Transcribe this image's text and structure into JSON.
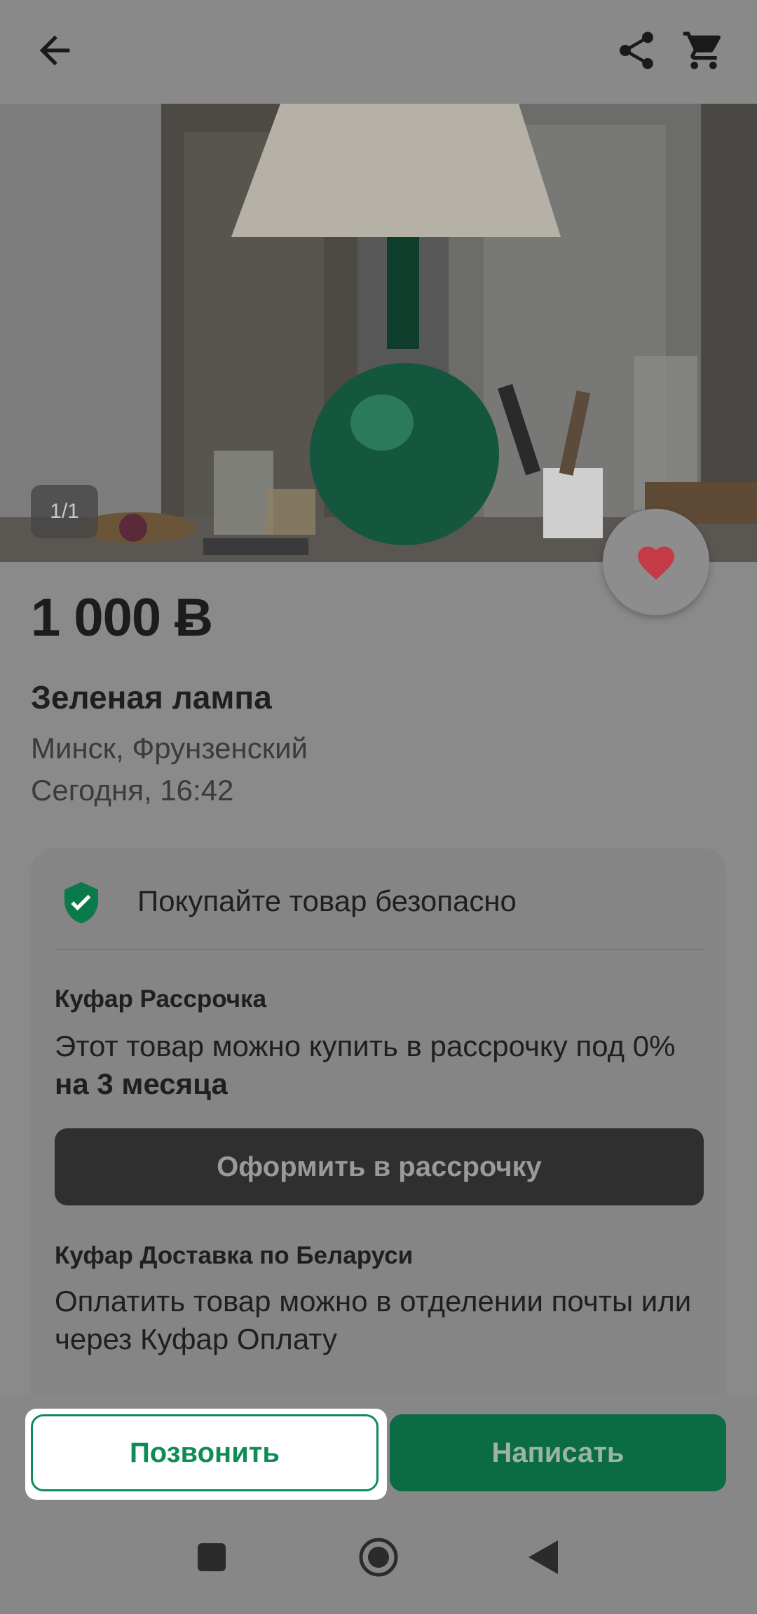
{
  "header": {
    "back_icon": "arrow-left-icon",
    "share_icon": "share-icon",
    "cart_icon": "cart-icon"
  },
  "gallery": {
    "counter": "1/1"
  },
  "listing": {
    "price": "1 000 Ƀ",
    "title": "Зеленая лампа",
    "location": "Минск, Фрунзенский",
    "date": "Сегодня, 16:42"
  },
  "safety": {
    "label": "Покупайте товар безопасно"
  },
  "installment": {
    "title": "Куфар Рассрочка",
    "text_prefix": "Этот товар можно купить в рассрочку под 0% ",
    "text_bold": "на 3 месяца",
    "button": "Оформить в рассрочку"
  },
  "delivery": {
    "title": "Куфар Доставка по Беларуси",
    "text": "Оплатить товар можно в отделении почты или через Куфар Оплату"
  },
  "actions": {
    "call": "Позвонить",
    "message": "Написать"
  },
  "colors": {
    "accent_green": "#0e8c57",
    "favorite_red": "#c43a45"
  }
}
